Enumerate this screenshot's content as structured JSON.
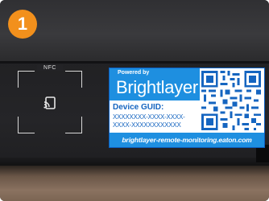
{
  "step_badge": "1",
  "nfc": {
    "label": "NFC",
    "icon": "nfc-phone-icon"
  },
  "label": {
    "powered_by": "Powered by",
    "brand": "Brightlayer",
    "guid_heading": "Device GUID:",
    "guid_line1": "XXXXXXXX-XXXX-XXXX-",
    "guid_line2": "XXXX-XXXXXXXXXXXX",
    "url": "brightlayer-remote-monitoring.eaton.com",
    "qr_icon": "qr-code-icon"
  },
  "colors": {
    "badge": "#f2901c",
    "brand_blue": "#1e8fe0",
    "text_blue": "#1565c0",
    "device_body": "#232326"
  }
}
